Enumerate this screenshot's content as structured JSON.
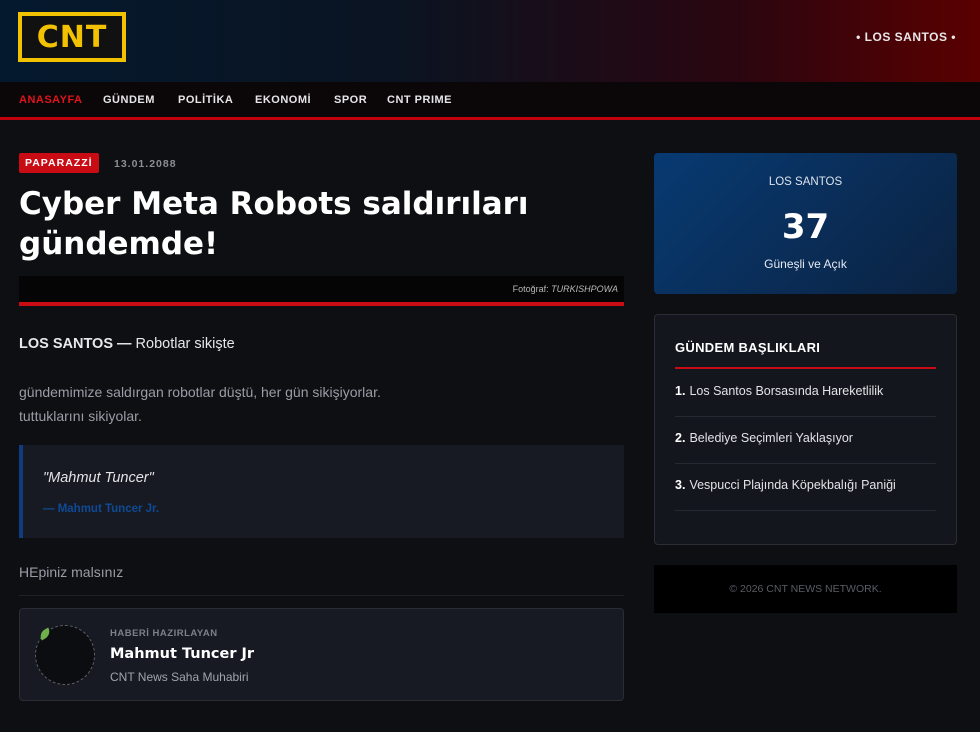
{
  "header": {
    "logo_text": "CNT",
    "city_tag": "• LOS SANTOS •"
  },
  "nav": {
    "items": [
      {
        "label": "ANASAYFA",
        "active": true
      },
      {
        "label": "GÜNDEM",
        "active": false
      },
      {
        "label": "POLİTİKA",
        "active": false
      },
      {
        "label": "EKONOMİ",
        "active": false
      },
      {
        "label": "SPOR",
        "active": false
      },
      {
        "label": "CNT PRIME",
        "active": false
      }
    ]
  },
  "article": {
    "category": "PAPARAZZİ",
    "date": "13.01.2088",
    "title": "Cyber Meta Robots saldırıları gündemde!",
    "photo_credit_label": "Fotoğraf:",
    "photo_credit_source": "TURKISHPOWA",
    "lede_location": "LOS SANTOS —",
    "lede_text": " Robotlar sikişte",
    "body_line1": "gündemimize saldırgan robotlar düştü, her gün sikişiyorlar.",
    "body_line2": "tuttuklarını sikiyolar.",
    "quote_text": "\"Mahmut Tuncer\"",
    "quote_author": "— Mahmut Tuncer Jr.",
    "closing": "HEpiniz malsınız"
  },
  "author": {
    "overline": "HABERİ HAZIRLAYAN",
    "name": "Mahmut Tuncer Jr",
    "role": "CNT News Saha Muhabiri"
  },
  "weather": {
    "city": "LOS SANTOS",
    "temperature": "37",
    "description": "Güneşli ve Açık"
  },
  "headlines": {
    "title": "GÜNDEM BAŞLIKLARI",
    "items": [
      {
        "num": "1.",
        "text": "Los Santos Borsasında Hareketlilik"
      },
      {
        "num": "2.",
        "text": "Belediye Seçimleri Yaklaşıyor"
      },
      {
        "num": "3.",
        "text": "Vespucci Plajında Köpekbalığı Paniği"
      }
    ]
  },
  "footer": {
    "text": "© 2026 CNT NEWS NETWORK."
  },
  "colors": {
    "accent_red": "#c90b14",
    "brand_yellow": "#f2c200",
    "quote_blue": "#0f4a96"
  }
}
